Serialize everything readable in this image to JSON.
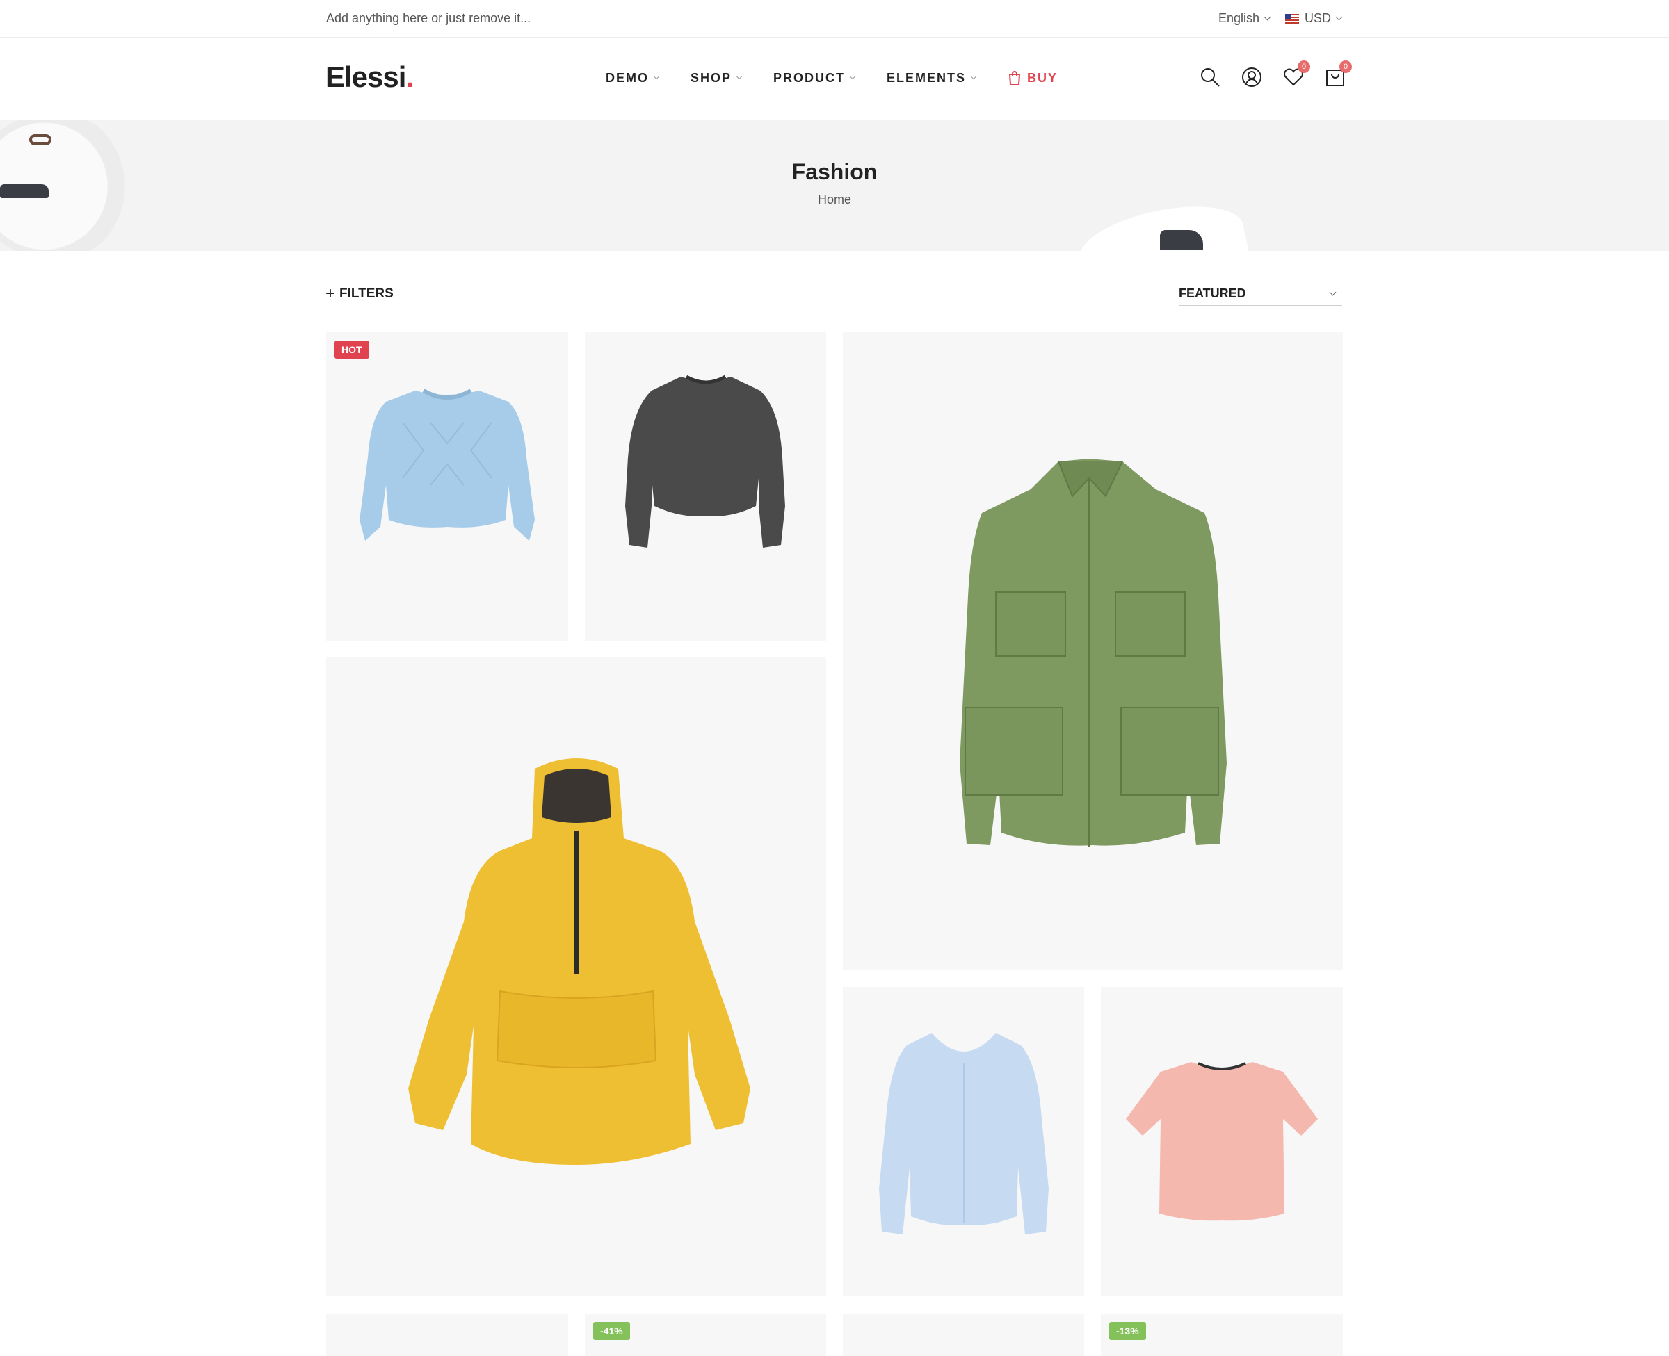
{
  "topbar": {
    "message": "Add anything here or just remove it...",
    "language": "English",
    "currency": "USD"
  },
  "header": {
    "logo_text": "Elessi",
    "logo_dot": ".",
    "nav": [
      {
        "label": "DEMO"
      },
      {
        "label": "SHOP"
      },
      {
        "label": "PRODUCT"
      },
      {
        "label": "ELEMENTS"
      },
      {
        "label": "BUY"
      }
    ],
    "wishlist_count": "0",
    "cart_count": "0",
    "icons": [
      "search-icon",
      "user-icon",
      "heart-icon",
      "cart-icon"
    ]
  },
  "hero": {
    "title": "Fashion",
    "breadcrumb": "Home"
  },
  "toolbar": {
    "filters_label": "FILTERS",
    "sort_selected": "FEATURED"
  },
  "products": [
    {
      "image": "blue-sweater",
      "tag": "HOT"
    },
    {
      "image": "charcoal-sweater",
      "tag": ""
    },
    {
      "image": "green-field-jacket",
      "tag": ""
    },
    {
      "image": "yellow-anorak",
      "tag": ""
    },
    {
      "image": "light-blue-cardigan",
      "tag": ""
    },
    {
      "image": "pink-tshirt",
      "tag": ""
    },
    {
      "image": "",
      "tag": ""
    },
    {
      "image": "",
      "tag": "-41%"
    },
    {
      "image": "",
      "tag": ""
    },
    {
      "image": "",
      "tag": "-13%"
    }
  ],
  "colors": {
    "accent": "#e0434f",
    "badge": "#e76d6d",
    "sale": "#84c15b",
    "card_bg": "#f7f7f7"
  }
}
